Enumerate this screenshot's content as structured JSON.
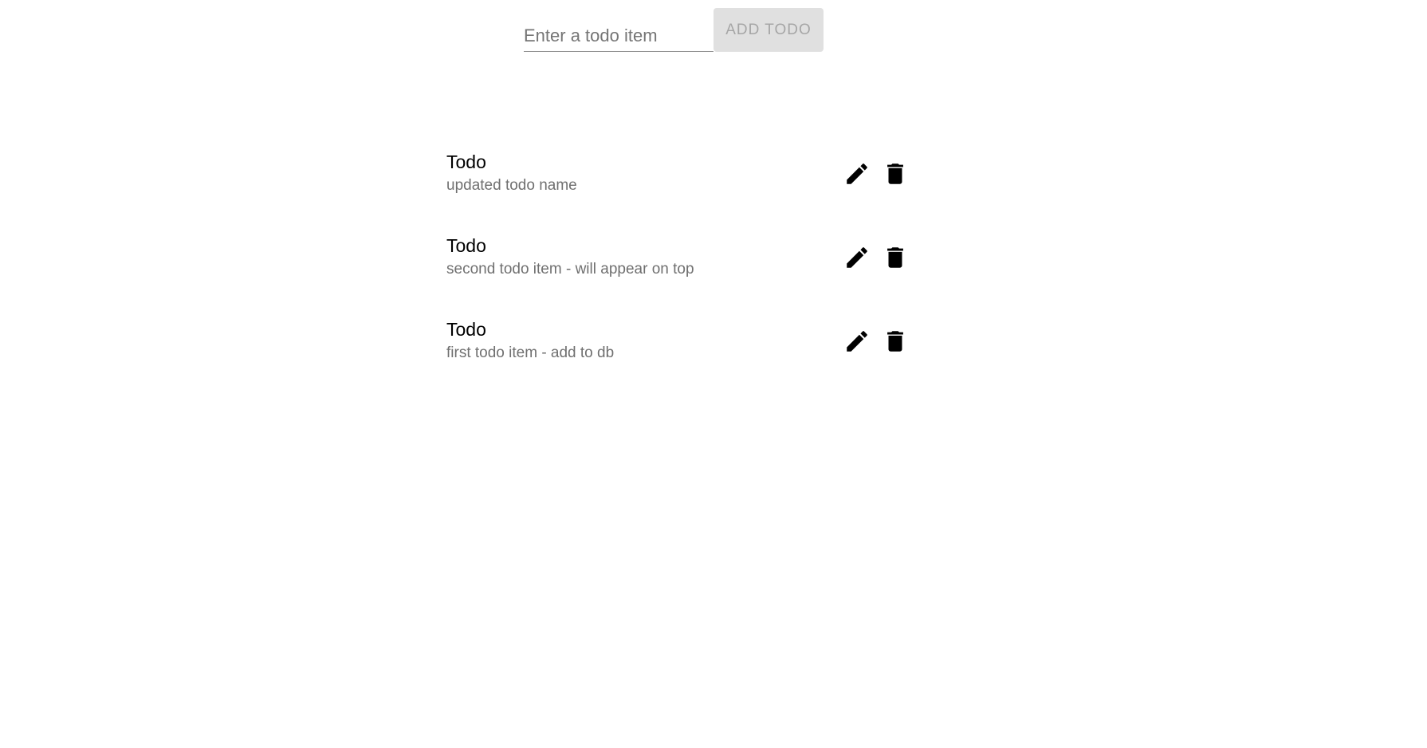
{
  "form": {
    "input_placeholder": "Enter a todo item",
    "input_value": "",
    "add_button_label": "ADD TODO"
  },
  "todos": [
    {
      "title": "Todo",
      "description": "updated todo name",
      "edit_icon": "pencil-icon",
      "delete_icon": "trash-icon"
    },
    {
      "title": "Todo",
      "description": "second todo item - will appear on top",
      "edit_icon": "pencil-icon",
      "delete_icon": "trash-icon"
    },
    {
      "title": "Todo",
      "description": "first todo item - add to db",
      "edit_icon": "pencil-icon",
      "delete_icon": "trash-icon"
    }
  ],
  "colors": {
    "button_bg": "#e0e0e0",
    "button_text": "#a6a6a6",
    "secondary_text": "#707070",
    "icon": "#000000"
  }
}
